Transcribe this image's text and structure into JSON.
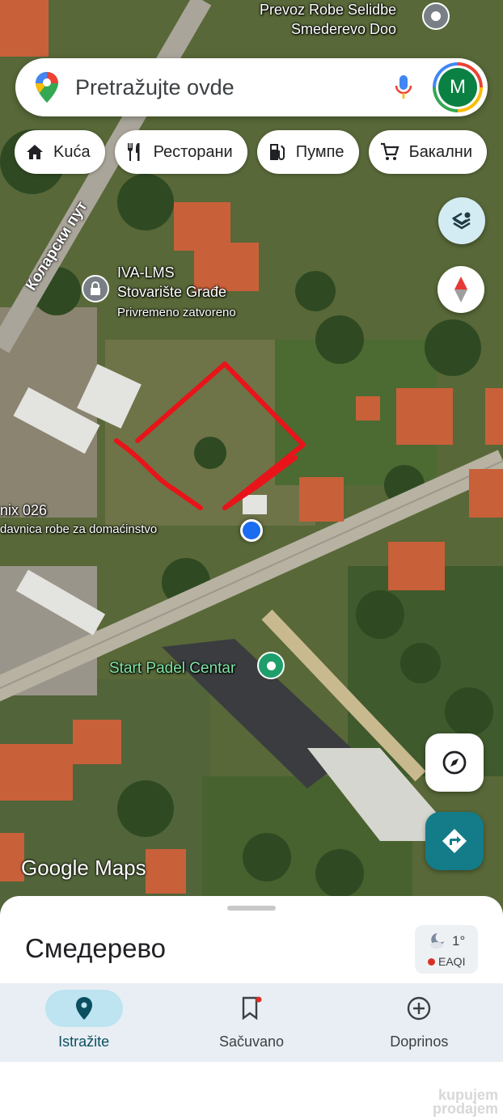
{
  "search": {
    "placeholder": "Pretražujte ovde",
    "avatar_letter": "M"
  },
  "chips": [
    {
      "label": "Kuća",
      "icon": "home-icon"
    },
    {
      "label": "Ресторани",
      "icon": "restaurant-icon"
    },
    {
      "label": "Пумпе",
      "icon": "gas-station-icon"
    },
    {
      "label": "Бакални",
      "icon": "grocery-cart-icon"
    }
  ],
  "map": {
    "pois": {
      "top_business_line1": "Prevoz Robe Selidbe",
      "top_business_line2": "Smederevo Doo",
      "iva_line1": "IVA-LMS",
      "iva_line2": "Stovarište Građe",
      "iva_status": "Privremeno zatvoreno",
      "shop_line1": "nix 026",
      "shop_line2": "davnica robe za domaćinstvo",
      "padel": "Start Padel Centar"
    },
    "street": "Коларски пут",
    "watermark": "Google Maps",
    "colors": {
      "annotation": "#e8141a",
      "location_dot": "#1a6cf0",
      "directions_button": "#137c88"
    }
  },
  "sheet": {
    "place_title": "Смедерево",
    "weather": {
      "temp": "1°",
      "air_quality": "EAQI"
    }
  },
  "nav": [
    {
      "label": "Istražite",
      "icon": "place-pin-icon",
      "active": true
    },
    {
      "label": "Sačuvano",
      "icon": "bookmark-icon",
      "active": false
    },
    {
      "label": "Doprinos",
      "icon": "add-circle-icon",
      "active": false
    }
  ],
  "overlay_mark": {
    "line1": "kupujem",
    "line2": "prodajem"
  }
}
